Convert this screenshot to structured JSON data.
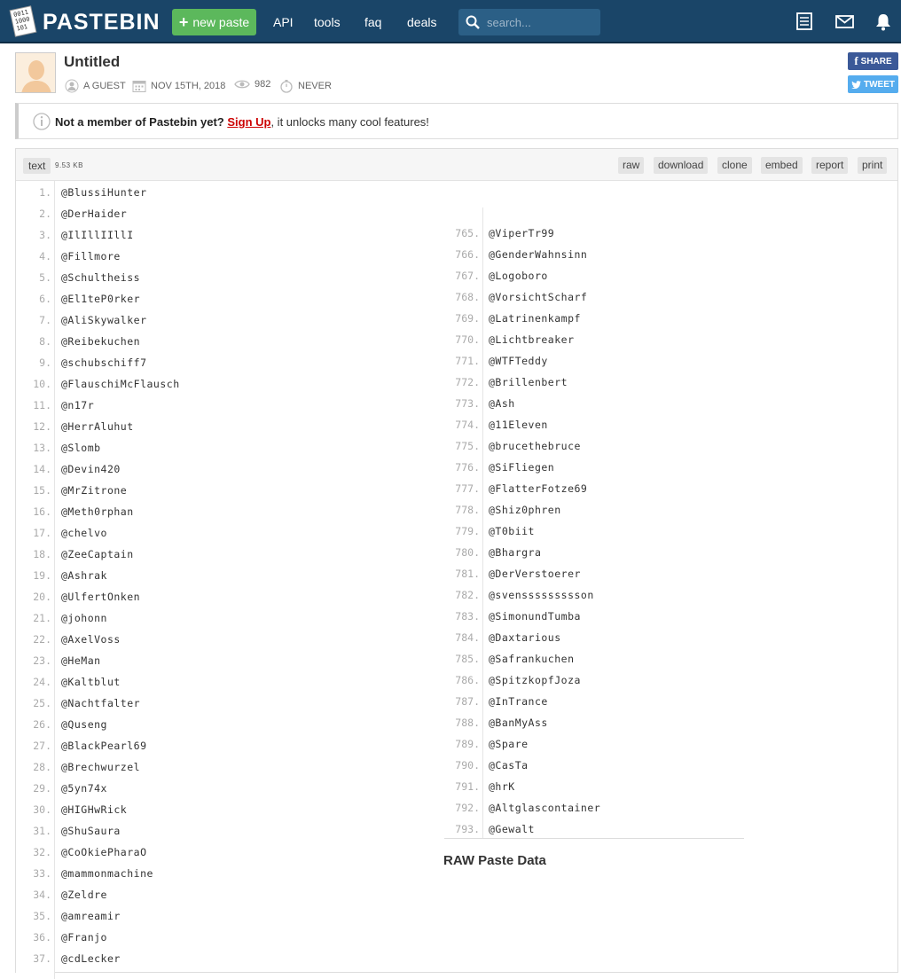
{
  "nav": {
    "brand": "PASTEBIN",
    "new_paste": "new paste",
    "links": [
      "API",
      "tools",
      "faq",
      "deals"
    ],
    "search_placeholder": "search..."
  },
  "paste": {
    "title": "Untitled",
    "author": "A GUEST",
    "date": "NOV 15TH, 2018",
    "views": "982",
    "expires": "NEVER",
    "share_label": "SHARE",
    "tweet_label": "TWEET"
  },
  "notice": {
    "lead": "Not a member of Pastebin yet?",
    "signup": "Sign Up",
    "rest": ", it unlocks many cool features!"
  },
  "toolbar": {
    "syntax": "text",
    "size": "9.53 KB",
    "buttons": [
      "raw",
      "download",
      "clone",
      "embed",
      "report",
      "print"
    ]
  },
  "lines_left": [
    {
      "n": "1.",
      "t": "@BlussiHunter"
    },
    {
      "n": "2.",
      "t": "@DerHaider"
    },
    {
      "n": "3.",
      "t": "@IlIllIIllI"
    },
    {
      "n": "4.",
      "t": "@Fillmore"
    },
    {
      "n": "5.",
      "t": "@Schultheiss"
    },
    {
      "n": "6.",
      "t": "@El1teP0rker"
    },
    {
      "n": "7.",
      "t": "@AliSkywalker"
    },
    {
      "n": "8.",
      "t": "@Reibekuchen"
    },
    {
      "n": "9.",
      "t": "@schubschiff7"
    },
    {
      "n": "10.",
      "t": "@FlauschiMcFlausch"
    },
    {
      "n": "11.",
      "t": "@n17r"
    },
    {
      "n": "12.",
      "t": "@HerrAluhut"
    },
    {
      "n": "13.",
      "t": "@Slomb"
    },
    {
      "n": "14.",
      "t": "@Devin420"
    },
    {
      "n": "15.",
      "t": "@MrZitrone"
    },
    {
      "n": "16.",
      "t": "@Meth0rphan"
    },
    {
      "n": "17.",
      "t": "@chelvo"
    },
    {
      "n": "18.",
      "t": "@ZeeCaptain"
    },
    {
      "n": "19.",
      "t": "@Ashrak"
    },
    {
      "n": "20.",
      "t": "@UlfertOnken"
    },
    {
      "n": "21.",
      "t": "@johonn"
    },
    {
      "n": "22.",
      "t": "@AxelVoss"
    },
    {
      "n": "23.",
      "t": "@HeMan"
    },
    {
      "n": "24.",
      "t": "@Kaltblut"
    },
    {
      "n": "25.",
      "t": "@Nachtfalter"
    },
    {
      "n": "26.",
      "t": "@Quseng"
    },
    {
      "n": "27.",
      "t": "@BlackPearl69"
    },
    {
      "n": "28.",
      "t": "@Brechwurzel"
    },
    {
      "n": "29.",
      "t": "@5yn74x"
    },
    {
      "n": "30.",
      "t": "@HIGHwRick"
    },
    {
      "n": "31.",
      "t": "@ShuSaura"
    },
    {
      "n": "32.",
      "t": "@CoOkiePharaO"
    },
    {
      "n": "33.",
      "t": "@mammonmachine"
    },
    {
      "n": "34.",
      "t": "@Zeldre"
    },
    {
      "n": "35.",
      "t": "@amreamir"
    },
    {
      "n": "36.",
      "t": "@Franjo"
    },
    {
      "n": "37.",
      "t": "@cdLecker"
    }
  ],
  "lines_right": [
    {
      "n": "765.",
      "t": "@ViperTr99"
    },
    {
      "n": "766.",
      "t": "@GenderWahnsinn"
    },
    {
      "n": "767.",
      "t": "@Logoboro"
    },
    {
      "n": "768.",
      "t": "@VorsichtScharf"
    },
    {
      "n": "769.",
      "t": "@Latrinenkampf"
    },
    {
      "n": "770.",
      "t": "@Lichtbreaker"
    },
    {
      "n": "771.",
      "t": "@WTFTeddy"
    },
    {
      "n": "772.",
      "t": "@Brillenbert"
    },
    {
      "n": "773.",
      "t": "@Ash"
    },
    {
      "n": "774.",
      "t": "@11Eleven"
    },
    {
      "n": "775.",
      "t": "@brucethebruce"
    },
    {
      "n": "776.",
      "t": "@SiFliegen"
    },
    {
      "n": "777.",
      "t": "@FlatterFotze69"
    },
    {
      "n": "778.",
      "t": "@Shiz0phren"
    },
    {
      "n": "779.",
      "t": "@T0biit"
    },
    {
      "n": "780.",
      "t": "@Bhargra"
    },
    {
      "n": "781.",
      "t": "@DerVerstoerer"
    },
    {
      "n": "782.",
      "t": "@svenssssssssson"
    },
    {
      "n": "783.",
      "t": "@SimonundTumba"
    },
    {
      "n": "784.",
      "t": "@Daxtarious"
    },
    {
      "n": "785.",
      "t": "@Safrankuchen"
    },
    {
      "n": "786.",
      "t": "@SpitzkopfJoza"
    },
    {
      "n": "787.",
      "t": "@InTrance"
    },
    {
      "n": "788.",
      "t": "@BanMyAss"
    },
    {
      "n": "789.",
      "t": "@Spare"
    },
    {
      "n": "790.",
      "t": "@CasTa"
    },
    {
      "n": "791.",
      "t": "@hrK"
    },
    {
      "n": "792.",
      "t": "@Altglascontainer"
    },
    {
      "n": "793.",
      "t": "@Gewalt"
    }
  ],
  "raw_title": "RAW Paste Data"
}
